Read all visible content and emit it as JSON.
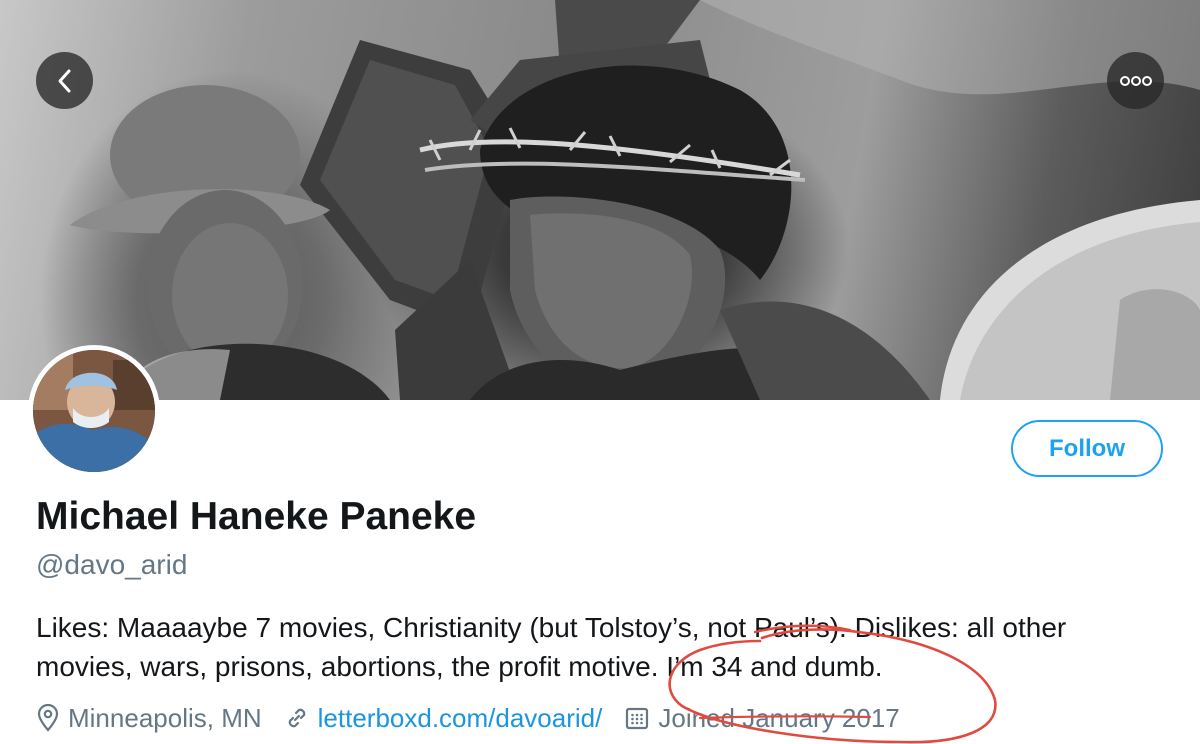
{
  "header": {
    "back_icon": "chevron-left-icon",
    "more_icon": "more-horizontal-icon"
  },
  "profile": {
    "name": "Michael Haneke Paneke",
    "handle": "@davo_arid",
    "bio_lines": [
      "Likes: Maaaaybe 7 movies, Christianity (but Tolstoy’s, not Paul’s). Dislikes: all other",
      "movies, wars, prisons, abortions, the profit motive. I’m 34 and dumb."
    ],
    "location": "Minneapolis, MN",
    "website": "letterboxd.com/davoarid/",
    "joined": "Joined January 2017",
    "follow_label": "Follow"
  },
  "colors": {
    "accent": "#1da1f2",
    "link": "#1b95e0",
    "muted": "#657786",
    "annotation": "#e04a3f"
  }
}
